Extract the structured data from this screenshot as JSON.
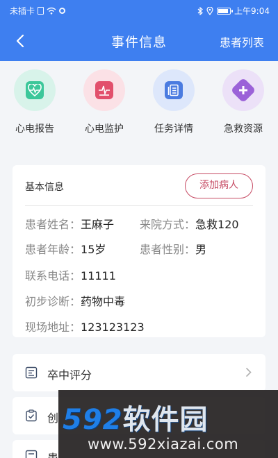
{
  "status_bar": {
    "carrier": "未插卡",
    "time": "上午9:04"
  },
  "header": {
    "title": "事件信息",
    "right_action": "患者列表",
    "background": "#3e7ff0"
  },
  "quick_actions": [
    {
      "label": "心电报告",
      "icon": "heart-ecg-icon",
      "bg": "#d8f3ea",
      "color": "#3cc79a"
    },
    {
      "label": "心电监护",
      "icon": "ecg-monitor-icon",
      "bg": "#fbe1e6",
      "color": "#e2506c"
    },
    {
      "label": "任务详情",
      "icon": "task-list-icon",
      "bg": "#dde7fb",
      "color": "#4a7be0"
    },
    {
      "label": "急救资源",
      "icon": "medical-cross-icon",
      "bg": "#ece1f8",
      "color": "#9b62d8"
    }
  ],
  "basic_info": {
    "title": "基本信息",
    "add_button": "添加病人",
    "name_label": "患者姓名：",
    "name": "王麻子",
    "arrival_label": "来院方式：",
    "arrival": "急救120",
    "age_label": "患者年龄：",
    "age": "15岁",
    "gender_label": "患者性别：",
    "gender": "男",
    "phone_label": "联系电话：",
    "phone": "11111",
    "diagnosis_label": "初步诊断：",
    "diagnosis": "药物中毒",
    "address_label": "现场地址：",
    "address": "123123123"
  },
  "list": [
    {
      "label": "卒中评分",
      "icon": "score-list-icon"
    },
    {
      "label": "创",
      "icon": "clipboard-check-icon"
    },
    {
      "label": "患",
      "icon": "document-icon"
    }
  ],
  "watermark": {
    "brand_digits": "592",
    "brand_text": "软件园",
    "url": "www.592xiazai.com"
  }
}
